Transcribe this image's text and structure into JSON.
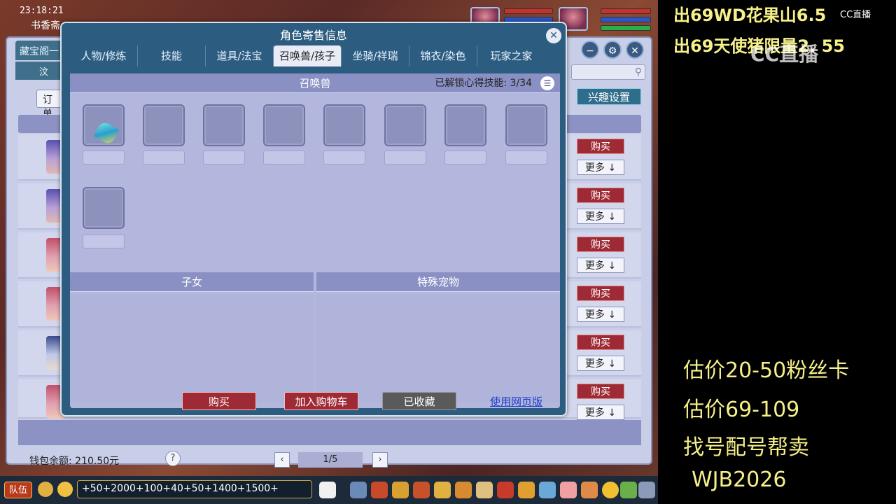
{
  "game": {
    "clock": "23:18:21",
    "location": "书香斋"
  },
  "market": {
    "tab1": "藏宝阁一",
    "tab2": "汶",
    "order_label": "订单",
    "interest_label": "兴趣设置",
    "row_buy_label": "购买",
    "row_more_label": "更多 ↓",
    "wallet": "钱包余额: 210.50元",
    "page": "1/5",
    "help": "?",
    "prev": "‹",
    "next": "›"
  },
  "dialog": {
    "title": "角色寄售信息",
    "close": "✕",
    "tabs": [
      {
        "label": "人物/修炼"
      },
      {
        "label": "技能"
      },
      {
        "label": "道具/法宝"
      },
      {
        "label": "召唤兽/孩子"
      },
      {
        "label": "坐骑/祥瑞"
      },
      {
        "label": "锦衣/染色"
      },
      {
        "label": "玩家之家"
      }
    ],
    "summon_header": "召唤兽",
    "unlock_text": "已解锁心得技能: 3/34",
    "children_header": "子女",
    "special_pet_header": "特殊宠物",
    "buy_label": "购买",
    "cart_label": "加入购物车",
    "fav_label": "已收藏",
    "web_label": "使用网页版"
  },
  "taskbar": {
    "team_label": "队伍",
    "chat_text": "+50+2000+100+40+50+1400+1500+"
  },
  "overlay": {
    "line1": "出69WD花果山6.5",
    "line2": "出69天使猪限量2. 55",
    "price1": "估价20-50粉丝卡",
    "price2": "估价69-109",
    "service": "找号配号帮卖",
    "code": "WJB2026",
    "logo": "CC直播",
    "logo_small": "CC直播"
  },
  "colors": {
    "overlay_yellow": "#f6f08a",
    "dialog_blue": "#2c5d80",
    "buy_red": "#9e2a35"
  }
}
